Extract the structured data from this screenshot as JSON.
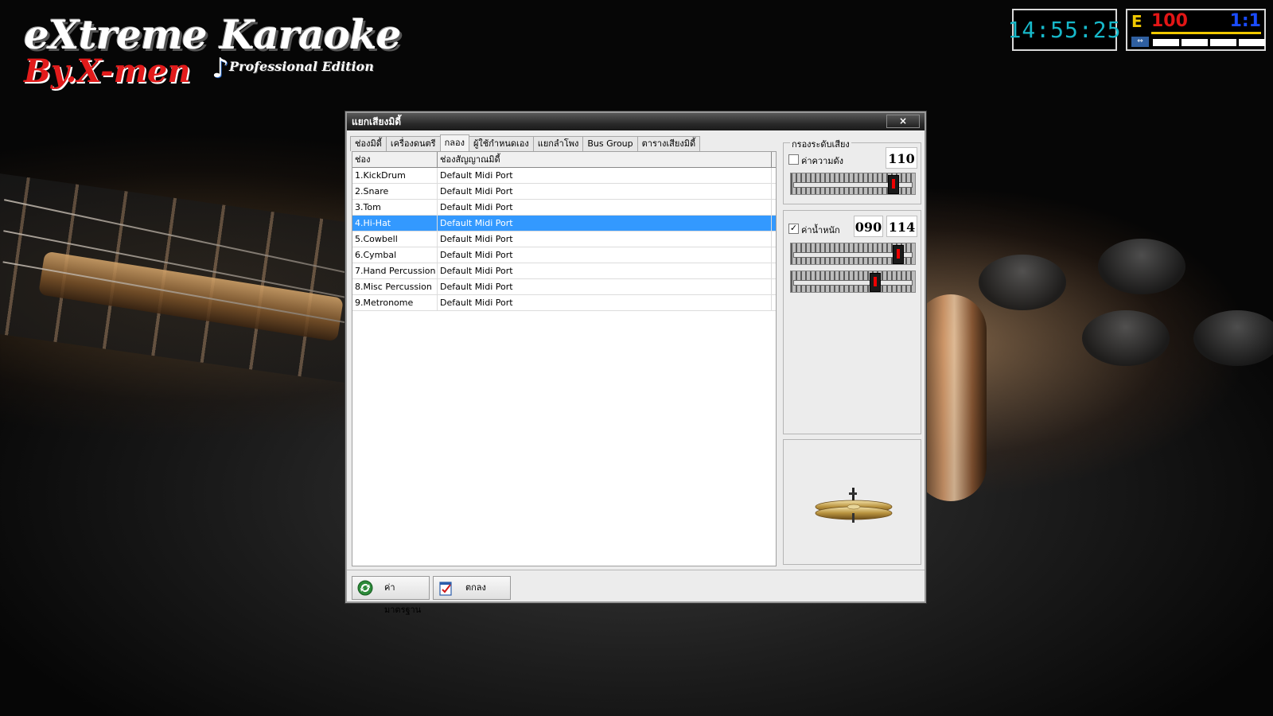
{
  "logo": {
    "main": "eXtreme Karaoke",
    "by": "By.X-men",
    "subtitle": "Professional Edition"
  },
  "clock": "14:55:25",
  "status": {
    "mode": "E",
    "score": "100",
    "ratio": "1:1"
  },
  "window": {
    "title": "แยกเสียงมิดี้",
    "close_label": "×",
    "tabs": [
      {
        "label": "ช่องมิดี้",
        "active": false
      },
      {
        "label": "เครื่องดนตรี",
        "active": false
      },
      {
        "label": "กลอง",
        "active": true
      },
      {
        "label": "ผู้ใช้กำหนดเอง",
        "active": false
      },
      {
        "label": "แยกลำโพง",
        "active": false
      },
      {
        "label": "Bus Group",
        "active": false
      },
      {
        "label": "ตารางเสียงมิดี้",
        "active": false
      }
    ],
    "table": {
      "headers": [
        "ช่อง",
        "ช่องสัญญาณมิดี้"
      ],
      "rows": [
        {
          "channel": "1.KickDrum",
          "port": "Default Midi Port",
          "selected": false
        },
        {
          "channel": "2.Snare",
          "port": "Default Midi Port",
          "selected": false
        },
        {
          "channel": "3.Tom",
          "port": "Default Midi Port",
          "selected": false
        },
        {
          "channel": "4.Hi-Hat",
          "port": "Default Midi Port",
          "selected": true
        },
        {
          "channel": "5.Cowbell",
          "port": "Default Midi Port",
          "selected": false
        },
        {
          "channel": "6.Cymbal",
          "port": "Default Midi Port",
          "selected": false
        },
        {
          "channel": "7.Hand Percussion",
          "port": "Default Midi Port",
          "selected": false
        },
        {
          "channel": "8.Misc Percussion",
          "port": "Default Midi Port",
          "selected": false
        },
        {
          "channel": "9.Metronome",
          "port": "Default Midi Port",
          "selected": false
        }
      ]
    },
    "filter": {
      "group_title": "กรองระดับเสียง",
      "volume_label": "ค่าความดัง",
      "volume_checked": false,
      "volume_value": "110",
      "volume_slider_fraction": 0.86,
      "weight_label": "ค่าน้ำหนัก",
      "weight_checked": true,
      "weight_low": "090",
      "weight_high": "114",
      "weight_slider1_fraction": 0.9,
      "weight_slider2_fraction": 0.7
    },
    "instrument_icon": "cymbal-icon",
    "buttons": {
      "default_label": "ค่ามาตรฐาน",
      "ok_label": "ตกลง"
    }
  },
  "colors": {
    "selection": "#3399ff",
    "clock_digits": "#17b8c9",
    "score": "#e21616",
    "ratio": "#1b4cff",
    "mode": "#f0c800"
  }
}
